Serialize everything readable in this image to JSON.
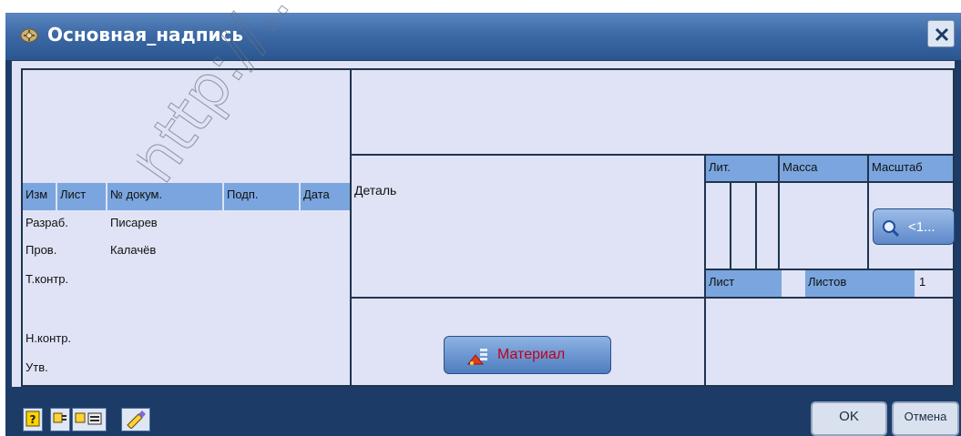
{
  "window": {
    "title": "Основная_надпись"
  },
  "stamp": {
    "headers": {
      "izm": "Изм",
      "list": "Лист",
      "doc_no": "№ докум.",
      "sign": "Подп.",
      "date": "Дата"
    },
    "rows": [
      {
        "role": "Разраб.",
        "name": "Писарев"
      },
      {
        "role": "Пров.",
        "name": "Калачёв"
      },
      {
        "role": "Т.контр.",
        "name": ""
      },
      {
        "role": "",
        "name": ""
      },
      {
        "role": "Н.контр.",
        "name": ""
      },
      {
        "role": "Утв.",
        "name": ""
      }
    ],
    "designation": "Деталь",
    "lit_label": "Лит.",
    "mass_label": "Масса",
    "scale_label": "Масштаб",
    "sheet_label": "Лист",
    "sheets_label": "Листов",
    "sheets_value": "1"
  },
  "buttons": {
    "material": "Материал",
    "scale": "<1...",
    "ok": "OK",
    "cancel": "Отмена"
  },
  "watermark_text": "http://...",
  "icons": [
    "app-icon",
    "close-icon",
    "search-icon",
    "material-icon",
    "help-icon",
    "tool-2-icon",
    "tool-3-icon",
    "edit-icon"
  ]
}
